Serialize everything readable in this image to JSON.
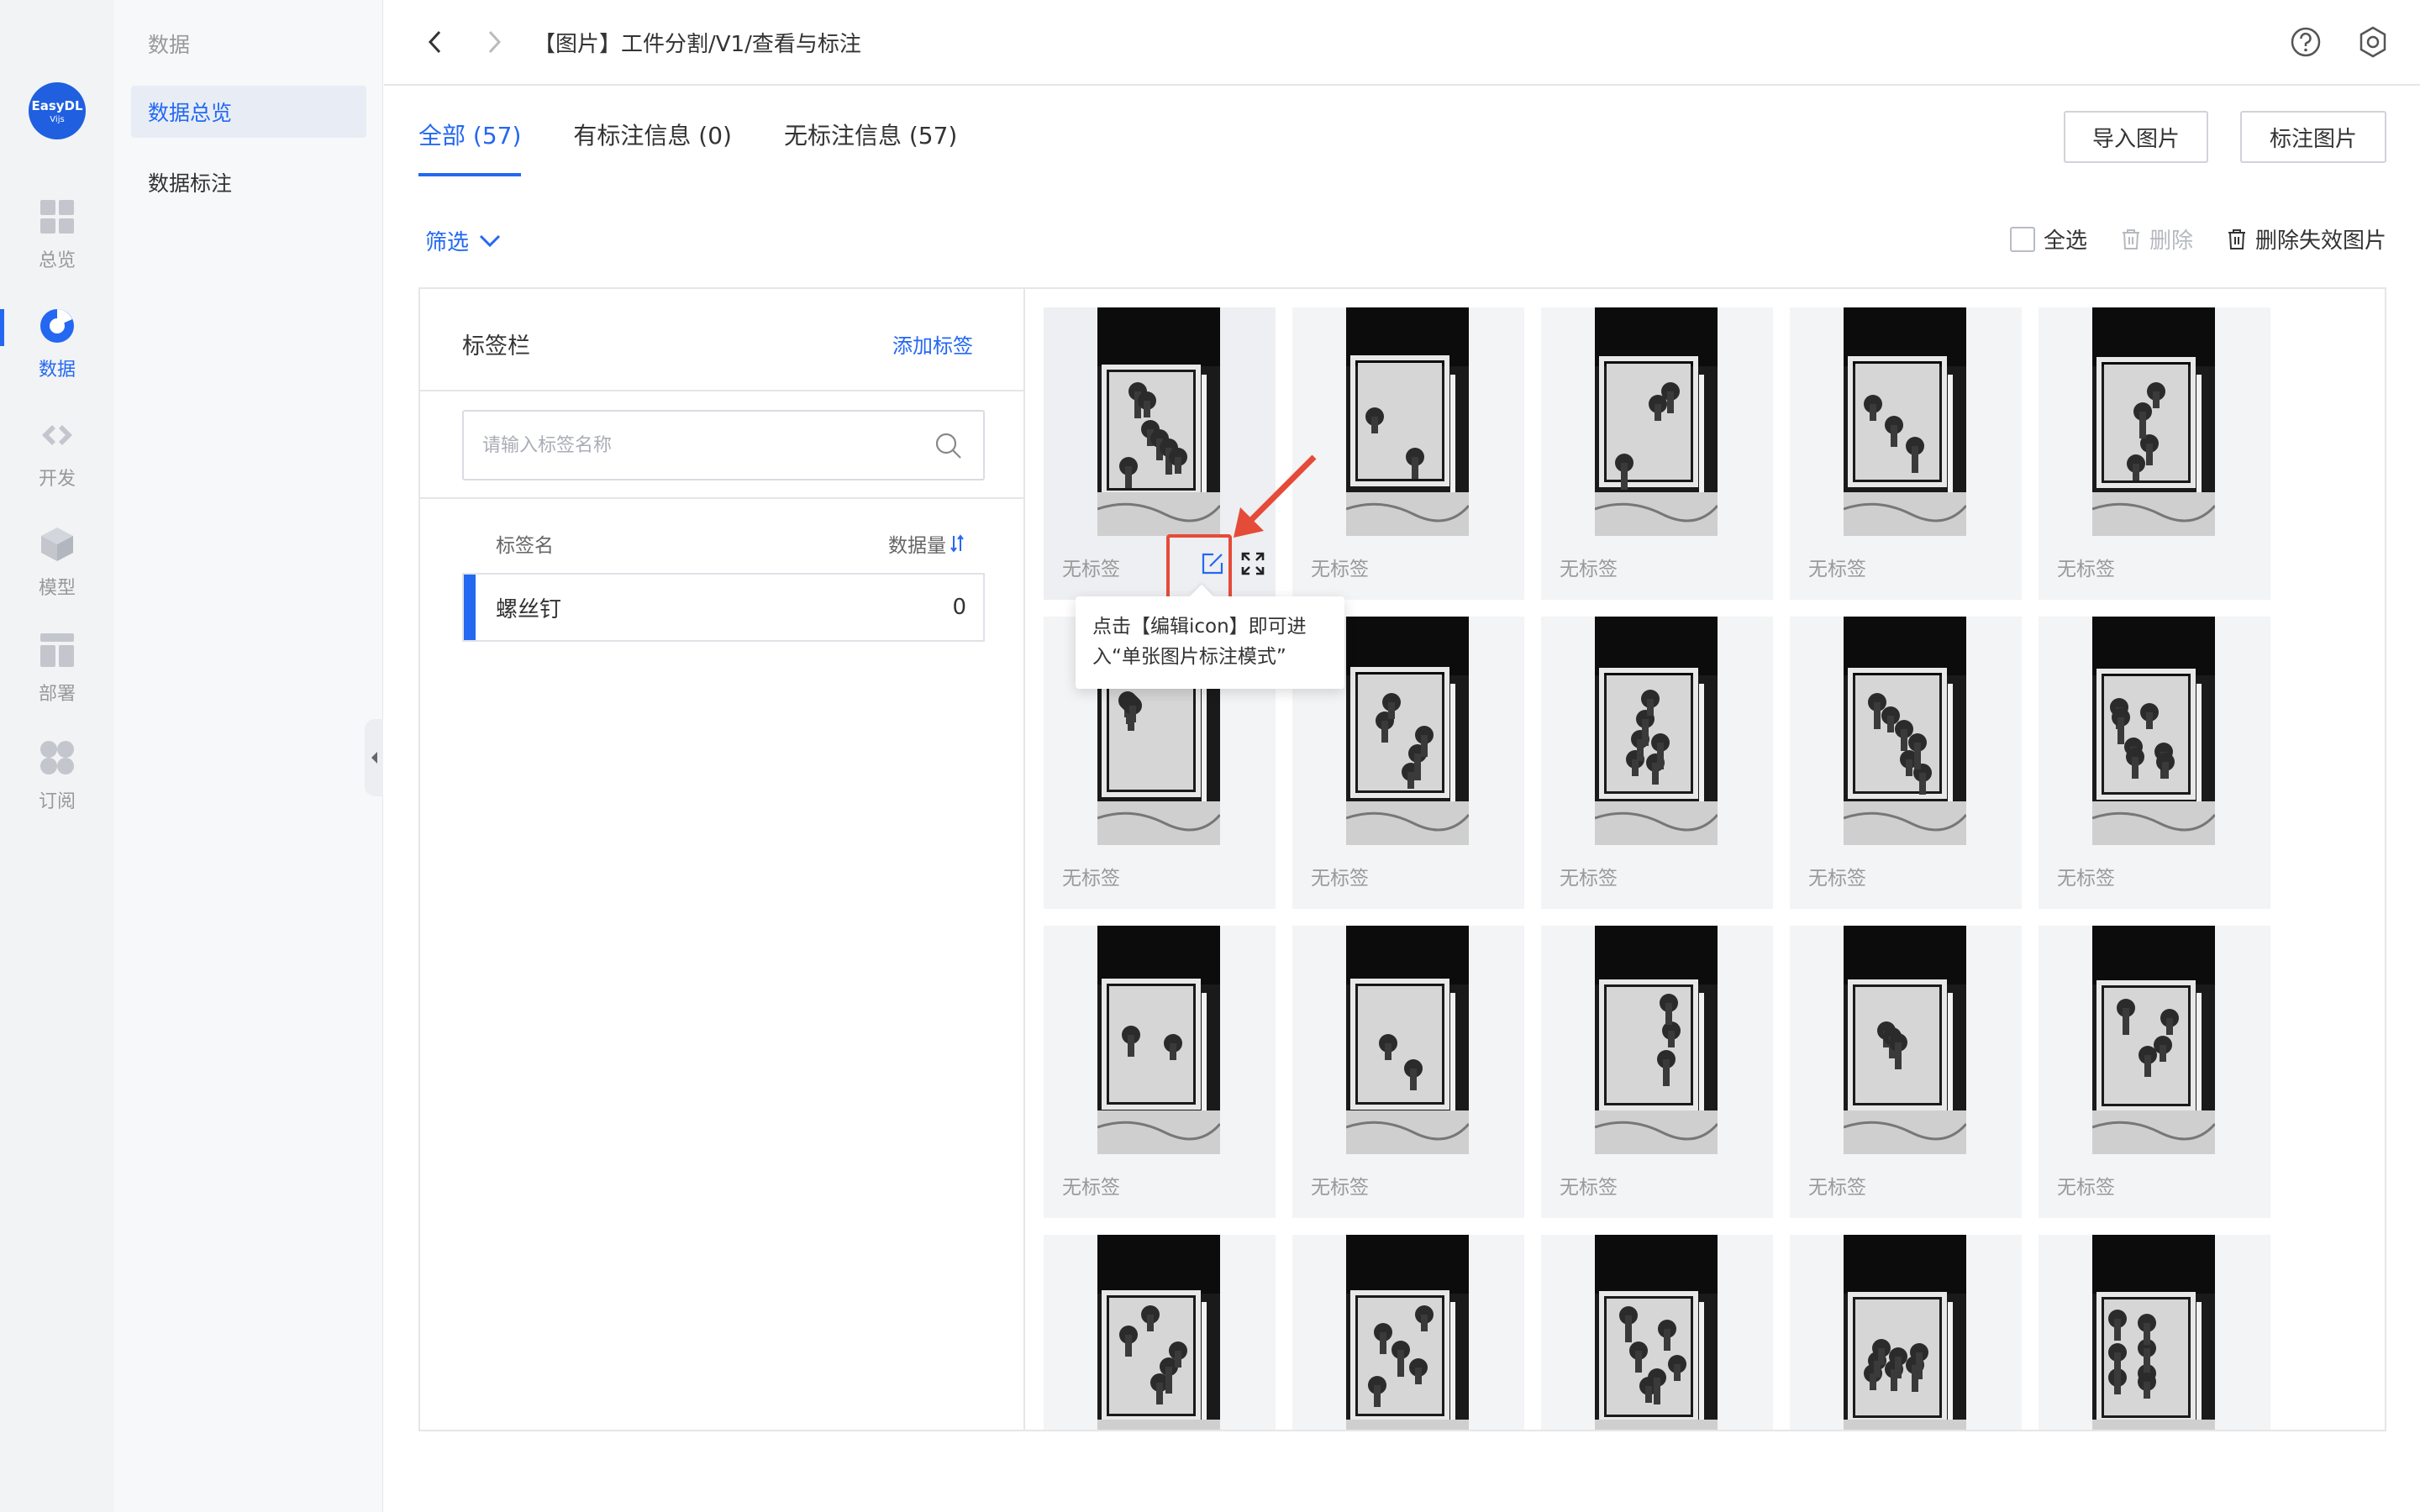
{
  "sidebar": {
    "logo_text": "EasyDL",
    "logo_sub": "Vijs",
    "items": [
      {
        "label": "总览",
        "icon": "dashboard-icon"
      },
      {
        "label": "数据",
        "icon": "data-icon"
      },
      {
        "label": "开发",
        "icon": "code-icon"
      },
      {
        "label": "模型",
        "icon": "cube-icon"
      },
      {
        "label": "部署",
        "icon": "deploy-icon"
      },
      {
        "label": "订阅",
        "icon": "subscribe-icon"
      }
    ],
    "active_index": 1
  },
  "subnav": {
    "title": "数据",
    "items": [
      {
        "label": "数据总览"
      },
      {
        "label": "数据标注"
      }
    ]
  },
  "header": {
    "breadcrumb": "【图片】工件分割/V1/查看与标注",
    "help_icon": "help-icon",
    "settings_icon": "settings-icon"
  },
  "tabs": [
    {
      "label": "全部 (57)"
    },
    {
      "label": "有标注信息 (0)"
    },
    {
      "label": "无标注信息 (57)"
    }
  ],
  "actions": {
    "import_label": "导入图片",
    "annotate_label": "标注图片"
  },
  "toolbar": {
    "filter_label": "筛选",
    "select_all_label": "全选",
    "delete_label": "删除",
    "delete_invalid_label": "删除失效图片"
  },
  "label_panel": {
    "title": "标签栏",
    "add_label": "添加标签",
    "search_placeholder": "请输入标签名称",
    "col_name": "标签名",
    "col_count": "数据量",
    "rows": [
      {
        "name": "螺丝钉",
        "count": "0"
      }
    ]
  },
  "images": {
    "item_label": "无标签",
    "count_visible": 20
  },
  "tooltip": {
    "text": "点击【编辑icon】即可进入“单张图片标注模式”"
  },
  "colors": {
    "accent": "#2468f2",
    "annotation": "#e54b39"
  }
}
